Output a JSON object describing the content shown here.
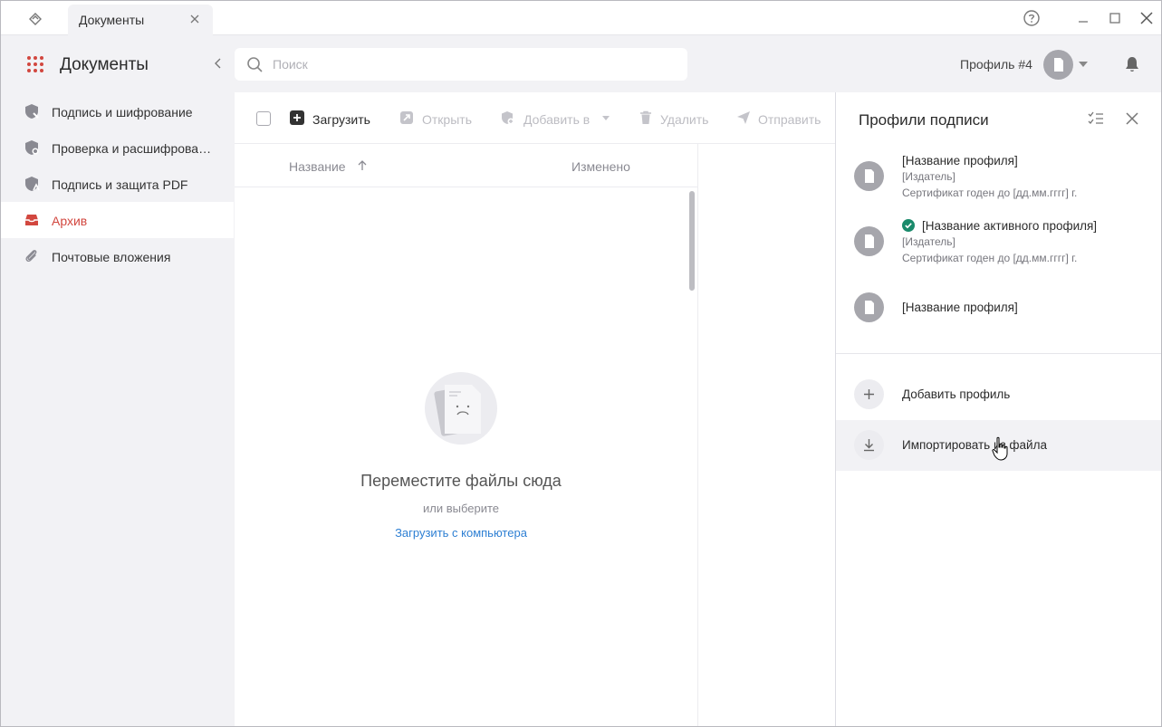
{
  "titlebar": {
    "tab_label": "Документы",
    "help_icon": "help-circle-icon"
  },
  "header": {
    "title": "Документы",
    "search_placeholder": "Поиск",
    "profile_label": "Профиль #4"
  },
  "sidebar": {
    "items": [
      {
        "label": "Подпись и шифрование",
        "icon": "shield-sign-icon",
        "active": false
      },
      {
        "label": "Проверка и расшифрован...",
        "icon": "shield-check-icon",
        "active": false
      },
      {
        "label": "Подпись и защита PDF",
        "icon": "shield-pdf-icon",
        "active": false
      },
      {
        "label": "Архив",
        "icon": "archive-icon",
        "active": true
      },
      {
        "label": "Почтовые вложения",
        "icon": "paperclip-icon",
        "active": false
      }
    ]
  },
  "toolbar": {
    "upload_label": "Загрузить",
    "open_label": "Открыть",
    "add_to_label": "Добавить в",
    "delete_label": "Удалить",
    "send_label": "Отправить"
  },
  "list": {
    "col_name": "Название",
    "col_modified": "Изменено"
  },
  "empty": {
    "title": "Переместите файлы сюда",
    "subtitle": "или выберите",
    "link": "Загрузить с компьютера"
  },
  "panel": {
    "title": "Профили подписи",
    "profiles": [
      {
        "name": "[Название профиля]",
        "issuer": "[Издатель]",
        "cert": "Сертификат годен до [дд.мм.гггг] г.",
        "active": false
      },
      {
        "name": "[Название активного профиля]",
        "issuer": "[Издатель]",
        "cert": "Сертификат годен до [дд.мм.гггг] г.",
        "active": true
      },
      {
        "name": "[Название профиля]",
        "active": false
      }
    ],
    "add_profile_label": "Добавить профиль",
    "import_label": "Импортировать из файла"
  },
  "colors": {
    "accent_red": "#d2473f",
    "link_blue": "#2d7fd3",
    "active_check_green": "#1a8a6b"
  }
}
